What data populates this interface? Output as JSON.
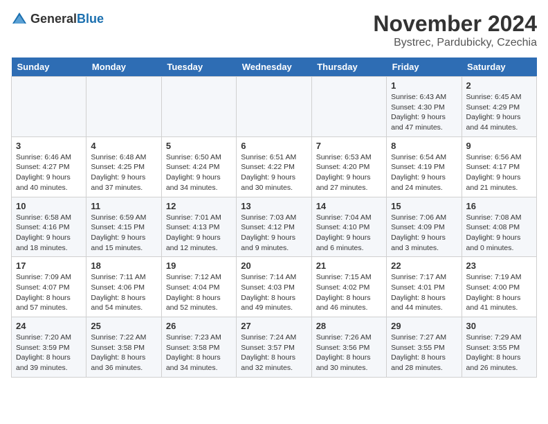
{
  "logo": {
    "text_general": "General",
    "text_blue": "Blue"
  },
  "title": "November 2024",
  "location": "Bystrec, Pardubicky, Czechia",
  "days_of_week": [
    "Sunday",
    "Monday",
    "Tuesday",
    "Wednesday",
    "Thursday",
    "Friday",
    "Saturday"
  ],
  "weeks": [
    [
      {
        "day": "",
        "info": ""
      },
      {
        "day": "",
        "info": ""
      },
      {
        "day": "",
        "info": ""
      },
      {
        "day": "",
        "info": ""
      },
      {
        "day": "",
        "info": ""
      },
      {
        "day": "1",
        "info": "Sunrise: 6:43 AM\nSunset: 4:30 PM\nDaylight: 9 hours and 47 minutes."
      },
      {
        "day": "2",
        "info": "Sunrise: 6:45 AM\nSunset: 4:29 PM\nDaylight: 9 hours and 44 minutes."
      }
    ],
    [
      {
        "day": "3",
        "info": "Sunrise: 6:46 AM\nSunset: 4:27 PM\nDaylight: 9 hours and 40 minutes."
      },
      {
        "day": "4",
        "info": "Sunrise: 6:48 AM\nSunset: 4:25 PM\nDaylight: 9 hours and 37 minutes."
      },
      {
        "day": "5",
        "info": "Sunrise: 6:50 AM\nSunset: 4:24 PM\nDaylight: 9 hours and 34 minutes."
      },
      {
        "day": "6",
        "info": "Sunrise: 6:51 AM\nSunset: 4:22 PM\nDaylight: 9 hours and 30 minutes."
      },
      {
        "day": "7",
        "info": "Sunrise: 6:53 AM\nSunset: 4:20 PM\nDaylight: 9 hours and 27 minutes."
      },
      {
        "day": "8",
        "info": "Sunrise: 6:54 AM\nSunset: 4:19 PM\nDaylight: 9 hours and 24 minutes."
      },
      {
        "day": "9",
        "info": "Sunrise: 6:56 AM\nSunset: 4:17 PM\nDaylight: 9 hours and 21 minutes."
      }
    ],
    [
      {
        "day": "10",
        "info": "Sunrise: 6:58 AM\nSunset: 4:16 PM\nDaylight: 9 hours and 18 minutes."
      },
      {
        "day": "11",
        "info": "Sunrise: 6:59 AM\nSunset: 4:15 PM\nDaylight: 9 hours and 15 minutes."
      },
      {
        "day": "12",
        "info": "Sunrise: 7:01 AM\nSunset: 4:13 PM\nDaylight: 9 hours and 12 minutes."
      },
      {
        "day": "13",
        "info": "Sunrise: 7:03 AM\nSunset: 4:12 PM\nDaylight: 9 hours and 9 minutes."
      },
      {
        "day": "14",
        "info": "Sunrise: 7:04 AM\nSunset: 4:10 PM\nDaylight: 9 hours and 6 minutes."
      },
      {
        "day": "15",
        "info": "Sunrise: 7:06 AM\nSunset: 4:09 PM\nDaylight: 9 hours and 3 minutes."
      },
      {
        "day": "16",
        "info": "Sunrise: 7:08 AM\nSunset: 4:08 PM\nDaylight: 9 hours and 0 minutes."
      }
    ],
    [
      {
        "day": "17",
        "info": "Sunrise: 7:09 AM\nSunset: 4:07 PM\nDaylight: 8 hours and 57 minutes."
      },
      {
        "day": "18",
        "info": "Sunrise: 7:11 AM\nSunset: 4:06 PM\nDaylight: 8 hours and 54 minutes."
      },
      {
        "day": "19",
        "info": "Sunrise: 7:12 AM\nSunset: 4:04 PM\nDaylight: 8 hours and 52 minutes."
      },
      {
        "day": "20",
        "info": "Sunrise: 7:14 AM\nSunset: 4:03 PM\nDaylight: 8 hours and 49 minutes."
      },
      {
        "day": "21",
        "info": "Sunrise: 7:15 AM\nSunset: 4:02 PM\nDaylight: 8 hours and 46 minutes."
      },
      {
        "day": "22",
        "info": "Sunrise: 7:17 AM\nSunset: 4:01 PM\nDaylight: 8 hours and 44 minutes."
      },
      {
        "day": "23",
        "info": "Sunrise: 7:19 AM\nSunset: 4:00 PM\nDaylight: 8 hours and 41 minutes."
      }
    ],
    [
      {
        "day": "24",
        "info": "Sunrise: 7:20 AM\nSunset: 3:59 PM\nDaylight: 8 hours and 39 minutes."
      },
      {
        "day": "25",
        "info": "Sunrise: 7:22 AM\nSunset: 3:58 PM\nDaylight: 8 hours and 36 minutes."
      },
      {
        "day": "26",
        "info": "Sunrise: 7:23 AM\nSunset: 3:58 PM\nDaylight: 8 hours and 34 minutes."
      },
      {
        "day": "27",
        "info": "Sunrise: 7:24 AM\nSunset: 3:57 PM\nDaylight: 8 hours and 32 minutes."
      },
      {
        "day": "28",
        "info": "Sunrise: 7:26 AM\nSunset: 3:56 PM\nDaylight: 8 hours and 30 minutes."
      },
      {
        "day": "29",
        "info": "Sunrise: 7:27 AM\nSunset: 3:55 PM\nDaylight: 8 hours and 28 minutes."
      },
      {
        "day": "30",
        "info": "Sunrise: 7:29 AM\nSunset: 3:55 PM\nDaylight: 8 hours and 26 minutes."
      }
    ]
  ]
}
